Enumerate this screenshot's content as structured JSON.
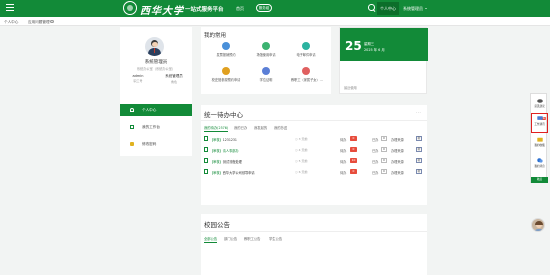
{
  "header": {
    "logo_text": "西华大学",
    "platform_name": "一站式服务平台",
    "nav_home": "首页",
    "nav_button": "服务组",
    "nav_personal": "个人中心",
    "user_menu": "系统管理员"
  },
  "tabs": [
    {
      "label": "个人中心"
    },
    {
      "label": "应用问题管理"
    }
  ],
  "profile": {
    "name": "系统管理员",
    "org": "系统办公室（系统办公室）",
    "stats": [
      {
        "value": "admin",
        "label": "职工号"
      },
      {
        "value": "系统管理员",
        "label": "角色"
      }
    ]
  },
  "sidemenu": [
    {
      "label": "个人中心",
      "icon": "person-icon",
      "active": true
    },
    {
      "label": "我的工作台",
      "icon": "document-icon",
      "active": false
    },
    {
      "label": "修改密码",
      "icon": "lock-icon",
      "active": false
    }
  ],
  "common": {
    "title": "我的常用",
    "apps": [
      {
        "label": "发票报销预约",
        "color": "#4a90d9",
        "icon": "invoice-icon"
      },
      {
        "label": "场馆使用申请",
        "color": "#3cb371",
        "icon": "venue-icon"
      },
      {
        "label": "电子邮件申请",
        "color": "#2bb3a0",
        "icon": "email-icon"
      },
      {
        "label": "校史馆参观预约申请",
        "color": "#e0a020",
        "icon": "museum-icon"
      },
      {
        "label": "学位证明",
        "color": "#5b7fd6",
        "icon": "certificate-icon"
      },
      {
        "label": "教职工（家属子女）...",
        "color": "#e06060",
        "icon": "family-icon"
      }
    ]
  },
  "date": {
    "day": "25",
    "weekday": "星期三",
    "ymd": "2025 年 6 月",
    "recent": "最近使用"
  },
  "todo": {
    "title": "统一待办中心",
    "more": "...",
    "tabs": [
      "我的待办(2576)",
      "我的已办",
      "我发起的",
      "我的抄送"
    ],
    "rows": [
      {
        "tag": "【审核】",
        "title": "1231231",
        "time": "3 天前",
        "pending_label": "待办",
        "pending": "0",
        "done_label": "已办",
        "done": "0",
        "source_label": "办理来源",
        "source": "新"
      },
      {
        "tag": "【审核】",
        "title": "请人事部办",
        "time": "4 天前",
        "pending_label": "待办",
        "pending": "0",
        "done_label": "已办",
        "done": "0",
        "source_label": "办理来源",
        "source": "新"
      },
      {
        "tag": "【审核】",
        "title": "测试流程处理",
        "time": "5 天前",
        "pending_label": "待办",
        "pending": "10",
        "done_label": "已办",
        "done": "0",
        "source_label": "办理来源",
        "source": "新"
      },
      {
        "tag": "【审核】",
        "title": "西华大学公司领导申请",
        "time": "6 天前",
        "pending_label": "待办",
        "pending": "0",
        "done_label": "已办",
        "done": "0",
        "source_label": "办理来源",
        "source": "新"
      }
    ]
  },
  "notice": {
    "title": "校园公告",
    "tabs": [
      "全部公告",
      "部门公告",
      "教职工公告",
      "学生公告"
    ]
  },
  "rightbar": {
    "items": [
      {
        "label": "意见建议",
        "icon": "cloud-icon",
        "color": "#555555"
      },
      {
        "label": "工作通讯",
        "icon": "chat-icon",
        "color": "#4a7bd0"
      },
      {
        "label": "我的收藏",
        "icon": "folder-icon",
        "color": "#e0b21f"
      },
      {
        "label": "我的消息",
        "icon": "message-icon",
        "color": "#2b6fd0"
      }
    ],
    "badge": "99+",
    "collapse": "收起"
  },
  "colors": {
    "brand": "#128a38",
    "danger": "#e74c3c"
  }
}
